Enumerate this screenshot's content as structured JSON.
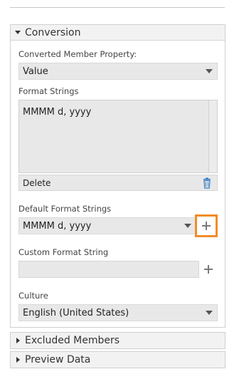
{
  "conversion": {
    "title": "Conversion",
    "converted_member_property": {
      "label": "Converted Member Property:",
      "value": "Value"
    },
    "format_strings": {
      "label": "Format Strings",
      "items": [
        "MMMM d, yyyy"
      ],
      "delete_label": "Delete"
    },
    "default_format_strings": {
      "label": "Default Format Strings",
      "value": "MMMM d, yyyy"
    },
    "custom_format_string": {
      "label": "Custom Format String",
      "value": ""
    },
    "culture": {
      "label": "Culture",
      "value": "English (United States)"
    }
  },
  "sections": {
    "excluded_members": {
      "title": "Excluded Members"
    },
    "preview_data": {
      "title": "Preview Data"
    }
  },
  "colors": {
    "highlight": "#f28c28",
    "trash_icon": "#3a7fc4",
    "field_bg": "#e8e8e8"
  },
  "icons": {
    "expand_open": "triangle-down-icon",
    "expand_closed": "triangle-right-icon",
    "delete": "trash-icon",
    "add": "plus-icon"
  }
}
